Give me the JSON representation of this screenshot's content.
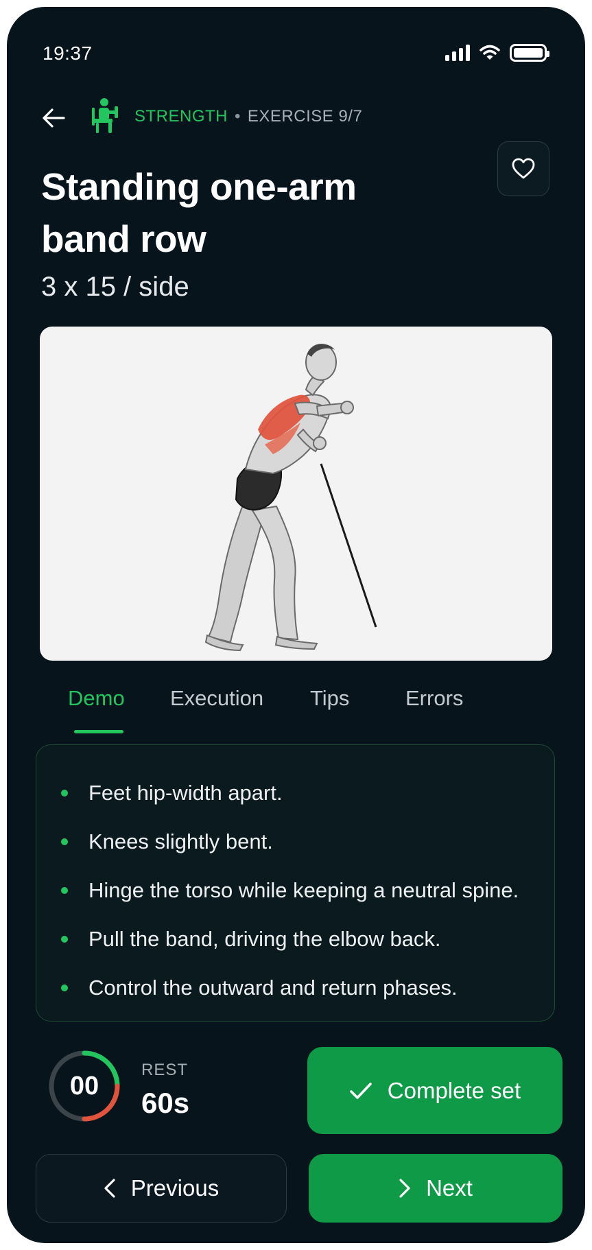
{
  "status_bar": {
    "time": "19:37"
  },
  "header": {
    "category": "STRENGTH",
    "separator": "•",
    "exercise_counter": "EXERCISE 9/7"
  },
  "exercise": {
    "title": "Standing one-arm band row",
    "sets_reps": "3 x 15 / side",
    "image_alt": "Illustration of a man in a staggered stance hinging at the hips and rowing a resistance band, back muscles highlighted in red"
  },
  "tabs": [
    {
      "label": "Demo",
      "active": true
    },
    {
      "label": "Execution",
      "active": false
    },
    {
      "label": "Tips",
      "active": false
    },
    {
      "label": "Errors",
      "active": false
    }
  ],
  "instructions": [
    "Feet hip-width apart.",
    "Knees slightly bent.",
    "Hinge the torso while keeping a neutral spine.",
    "Pull the band, driving the elbow back.",
    "Control the outward and return phases."
  ],
  "rest_timer": {
    "countdown": "00",
    "label": "REST",
    "duration": "60s"
  },
  "actions": {
    "complete_label": "Complete set",
    "previous_label": "Previous",
    "next_label": "Next"
  },
  "colors": {
    "background": "#08141b",
    "accent": "#22c55e",
    "button_green": "#0f9a48",
    "muscle_highlight": "#e0533d"
  },
  "icons": {
    "back": "arrow-left-icon",
    "category": "seated-strength-icon",
    "favorite": "heart-icon",
    "complete": "check-icon",
    "previous": "chevron-left-icon",
    "next": "chevron-right-icon"
  }
}
